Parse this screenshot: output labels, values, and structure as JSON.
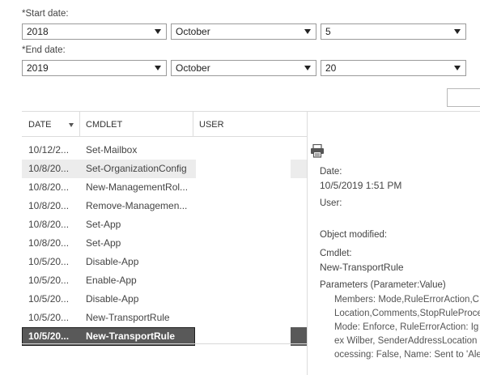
{
  "filters": {
    "start_label": "*Start date:",
    "start_year": "2018",
    "start_month": "October",
    "start_day": "5",
    "end_label": "*End date:",
    "end_year": "2019",
    "end_month": "October",
    "end_day": "20"
  },
  "table": {
    "columns": [
      "DATE",
      "CMDLET",
      "USER"
    ],
    "rows": [
      {
        "date": "10/12/2...",
        "cmdlet": "Set-Mailbox"
      },
      {
        "date": "10/8/20...",
        "cmdlet": "Set-OrganizationConfig"
      },
      {
        "date": "10/8/20...",
        "cmdlet": "New-ManagementRol..."
      },
      {
        "date": "10/8/20...",
        "cmdlet": "Remove-Managemen..."
      },
      {
        "date": "10/8/20...",
        "cmdlet": "Set-App"
      },
      {
        "date": "10/8/20...",
        "cmdlet": "Set-App"
      },
      {
        "date": "10/5/20...",
        "cmdlet": "Disable-App"
      },
      {
        "date": "10/5/20...",
        "cmdlet": "Enable-App"
      },
      {
        "date": "10/5/20...",
        "cmdlet": "Disable-App"
      },
      {
        "date": "10/5/20...",
        "cmdlet": "New-TransportRule"
      },
      {
        "date": "10/5/20...",
        "cmdlet": "New-TransportRule"
      }
    ]
  },
  "details": {
    "date_label": "Date:",
    "date_value": "10/5/2019 1:51 PM",
    "user_label": "User:",
    "object_label": "Object modified:",
    "cmdlet_label": "Cmdlet:",
    "cmdlet_value": "New-TransportRule",
    "params_label": "Parameters (Parameter:Value)",
    "params_lines": [
      "Members: Mode,RuleErrorAction,C",
      "Location,Comments,StopRuleProce",
      "Mode: Enforce, RuleErrorAction: Ig",
      "ex Wilber, SenderAddressLocation",
      "ocessing: False, Name: Sent to 'Ale"
    ]
  },
  "icons": {
    "print": "printer-icon",
    "dropdown": "chevron-down-icon",
    "sort": "sort-desc-icon"
  },
  "colors": {
    "selected_row": "#595959",
    "hover_row": "#ececec",
    "border": "#dcdcdc"
  }
}
